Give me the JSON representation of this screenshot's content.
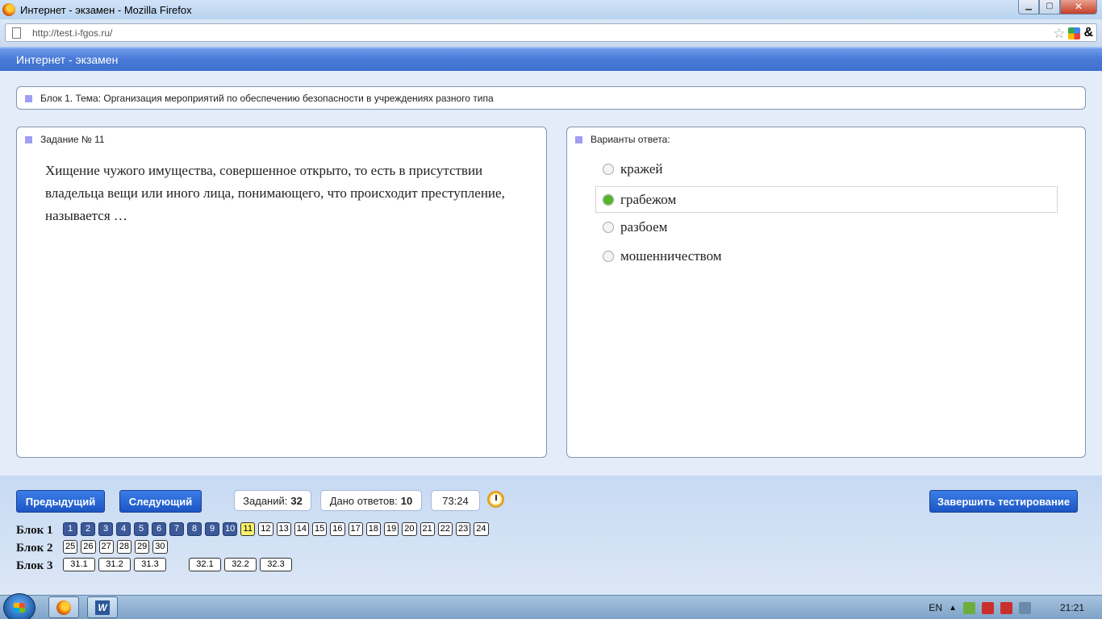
{
  "window": {
    "title": "Интернет - экзамен - Mozilla Firefox"
  },
  "browser": {
    "url": "http://test.i-fgos.ru/"
  },
  "app": {
    "title": "Интернет - экзамен"
  },
  "block_topic": "Блок 1. Тема: Организация мероприятий по обеспечению безопасности в учреждениях разного типа",
  "question": {
    "label": "Задание № 11",
    "text": "Хищение чужого имущества, совершенное открыто, то есть в присутствии владельца вещи или иного лица, понимающего, что происходит преступление, называется …"
  },
  "answers": {
    "label": "Варианты ответа:",
    "options": [
      "кражей",
      "грабежом",
      "разбоем",
      "мошенничеством"
    ],
    "selected_index": 1
  },
  "controls": {
    "prev": "Предыдущий",
    "next": "Следующий",
    "tasks_label": "Заданий:",
    "tasks_value": "32",
    "answered_label": "Дано ответов:",
    "answered_value": "10",
    "timer": "73:24",
    "finish": "Завершить тестирование"
  },
  "blocks": [
    {
      "label": "Блок 1",
      "items": [
        "1",
        "2",
        "3",
        "4",
        "5",
        "6",
        "7",
        "8",
        "9",
        "10",
        "11",
        "12",
        "13",
        "14",
        "15",
        "16",
        "17",
        "18",
        "19",
        "20",
        "21",
        "22",
        "23",
        "24"
      ]
    },
    {
      "label": "Блок 2",
      "items": [
        "25",
        "26",
        "27",
        "28",
        "29",
        "30"
      ]
    },
    {
      "label": "Блок 3",
      "items": [
        "31.1",
        "31.2",
        "31.3",
        "32.1",
        "32.2",
        "32.3"
      ]
    }
  ],
  "taskbar": {
    "lang": "EN",
    "time": "21:21"
  }
}
